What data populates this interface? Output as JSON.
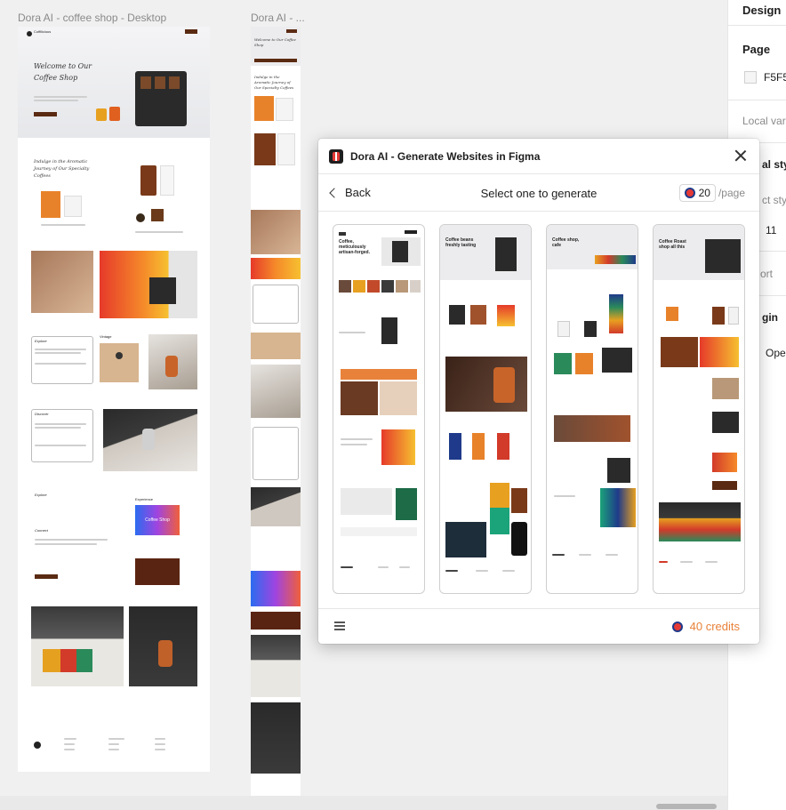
{
  "canvas": {
    "frame1_title": "Dora AI - coffee shop - Desktop",
    "frame2_title": "Dora AI - ...",
    "hero_title": "Welcome to Our Coffee Shop",
    "section_title": "Indulge in the Aromatic Journey of Our Specialty Coffees",
    "explore_label": "Explore",
    "discover_label": "Discover",
    "connect_label": "Connect",
    "experience_label": "Experience",
    "coffee_shop_label": "Coffee Shop",
    "brand": "Coffilicious"
  },
  "right_panel": {
    "tab_design": "Design",
    "page_label": "Page",
    "page_color": "F5F5",
    "local_variables": "Local vari",
    "local_styles": "al styl",
    "select_style": "ct sty",
    "number": "11",
    "export": "ort",
    "plugin": "gin",
    "open": "Oper"
  },
  "dialog": {
    "title": "Dora AI - Generate Websites in Figma",
    "back_label": "Back",
    "nav_title": "Select one to generate",
    "price_value": "20",
    "price_unit": "/page",
    "credits": "40 credits",
    "templates": [
      {
        "hero_text": "Coffee, meticulously artisan-forged."
      },
      {
        "hero_text": "Coffee beans freshly tasting"
      },
      {
        "hero_text": "Coffee shop, cafe"
      },
      {
        "hero_text": "Coffee Roast shop all this"
      }
    ]
  },
  "colors": {
    "accent_orange": "#e8823a",
    "brand_brown": "#5a2a12",
    "dialog_bg": "#ffffff"
  }
}
